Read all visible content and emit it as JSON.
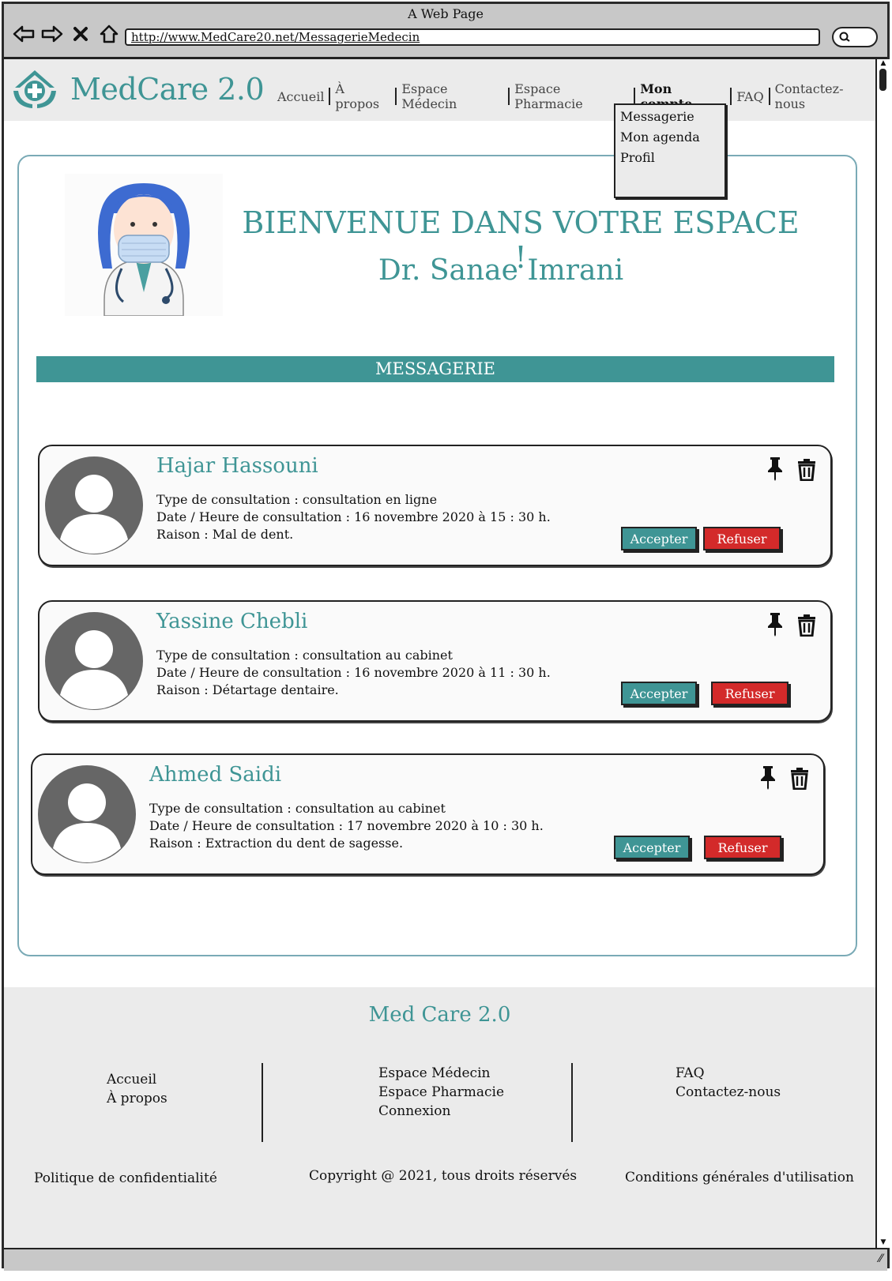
{
  "window": {
    "title": "A Web Page",
    "url": "http://www.MedCare20.net/MessagerieMedecin"
  },
  "header": {
    "brand": "MedCare 2.0",
    "nav": [
      "Accueil",
      "À propos",
      "Espace Médecin",
      "Espace Pharmacie",
      "Mon compte",
      "FAQ",
      "Contactez-nous"
    ],
    "active": "Mon compte",
    "dropdown": [
      "Messagerie",
      "Mon agenda",
      "Profil"
    ]
  },
  "welcome": {
    "title": "BIENVENUE DANS VOTRE ESPACE !",
    "doctor": "Dr. Sanae Imrani"
  },
  "section_title": "MESSAGERIE",
  "labels": {
    "type": "Type de consultation : ",
    "date": "Date / Heure de consultation : ",
    "reason": "Raison : ",
    "accept": "Accepter",
    "refuse": "Refuser"
  },
  "messages": [
    {
      "name": "Hajar Hassouni",
      "type": "consultation en ligne",
      "date": "16 novembre 2020 à 15 : 30 h.",
      "reason": "Mal de dent."
    },
    {
      "name": "Yassine Chebli",
      "type": "consultation au cabinet",
      "date": "16 novembre 2020 à 11 : 30 h.",
      "reason": "Détartage dentaire."
    },
    {
      "name": "Ahmed Saidi",
      "type": "consultation au cabinet",
      "date": "17 novembre 2020 à 10 : 30 h.",
      "reason": "Extraction du dent de sagesse."
    }
  ],
  "footer": {
    "brand": "Med Care 2.0",
    "col1": [
      "Accueil",
      "À propos"
    ],
    "col2": [
      "Espace Médecin",
      "Espace Pharmacie",
      "Connexion"
    ],
    "col3": [
      "FAQ",
      "Contactez-nous"
    ],
    "privacy": "Politique de confidentialité",
    "copyright": "Copyright @ 2021, tous droits réservés",
    "terms": "Conditions générales d'utilisation"
  },
  "colors": {
    "accent": "#3f9595",
    "danger": "#d32a2a",
    "chrome": "#c8c8c8",
    "header_bg": "#ebebeb"
  },
  "icons": [
    "back-arrow-icon",
    "forward-arrow-icon",
    "close-icon",
    "home-icon",
    "search-icon",
    "pin-icon",
    "trash-icon",
    "user-avatar-icon"
  ]
}
